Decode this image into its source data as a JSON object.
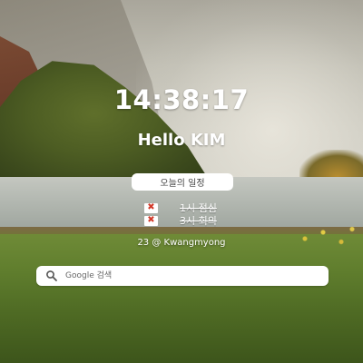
{
  "clock": {
    "time": "14:38:17"
  },
  "greeting": "Hello KIM",
  "schedule": {
    "button_label": "오늘의 일정",
    "items": [
      {
        "label": "1시 점심",
        "done": true
      },
      {
        "label": "3시 회의",
        "done": true
      }
    ]
  },
  "location": {
    "text": "23 @ Kwangmyong"
  },
  "search": {
    "placeholder": "Google 검색",
    "value": ""
  },
  "icons": {
    "delete": "x-mark-icon",
    "search": "search-icon"
  },
  "colors": {
    "delete_mark": "#d23a2a"
  }
}
